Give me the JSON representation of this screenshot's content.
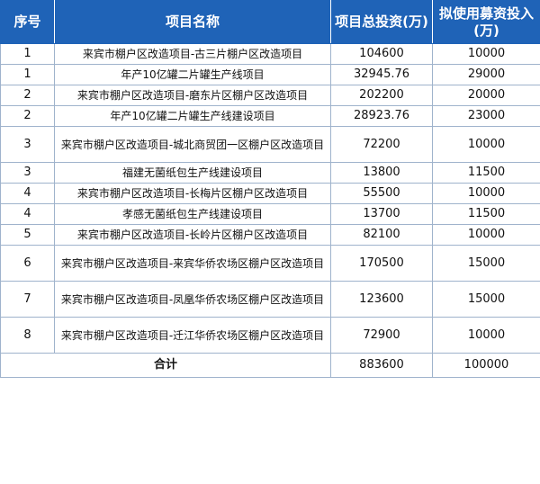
{
  "table": {
    "headers": {
      "no": "序号",
      "name": "项目名称",
      "total": "项目总投资(万)",
      "raise": "拟使用募资投入(万)"
    },
    "rows": [
      {
        "no": "1",
        "name": "来宾市棚户区改造项目-古三片棚户区改造项目",
        "total": "104600",
        "raise": "10000"
      },
      {
        "no": "1",
        "name": "年产10亿罐二片罐生产线项目",
        "total": "32945.76",
        "raise": "29000"
      },
      {
        "no": "2",
        "name": "来宾市棚户区改造项目-磨东片区棚户区改造项目",
        "total": "202200",
        "raise": "20000"
      },
      {
        "no": "2",
        "name": "年产10亿罐二片罐生产线建设项目",
        "total": "28923.76",
        "raise": "23000"
      },
      {
        "no": "3",
        "name": "来宾市棚户区改造项目-城北商贸团一区棚户区改造项目",
        "total": "72200",
        "raise": "10000"
      },
      {
        "no": "3",
        "name": "福建无菌纸包生产线建设项目",
        "total": "13800",
        "raise": "11500"
      },
      {
        "no": "4",
        "name": "来宾市棚户区改造项目-长梅片区棚户区改造项目",
        "total": "55500",
        "raise": "10000"
      },
      {
        "no": "4",
        "name": "孝感无菌纸包生产线建设项目",
        "total": "13700",
        "raise": "11500"
      },
      {
        "no": "5",
        "name": "来宾市棚户区改造项目-长岭片区棚户区改造项目",
        "total": "82100",
        "raise": "10000"
      },
      {
        "no": "6",
        "name": "来宾市棚户区改造项目-来宾华侨农场区棚户区改造项目",
        "total": "170500",
        "raise": "15000"
      },
      {
        "no": "7",
        "name": "来宾市棚户区改造项目-凤凰华侨农场区棚户区改造项目",
        "total": "123600",
        "raise": "15000"
      },
      {
        "no": "8",
        "name": "来宾市棚户区改造项目-迁江华侨农场区棚户区改造项目",
        "total": "72900",
        "raise": "10000"
      }
    ],
    "footer": {
      "label": "合计",
      "total": "883600",
      "raise": "100000"
    }
  }
}
